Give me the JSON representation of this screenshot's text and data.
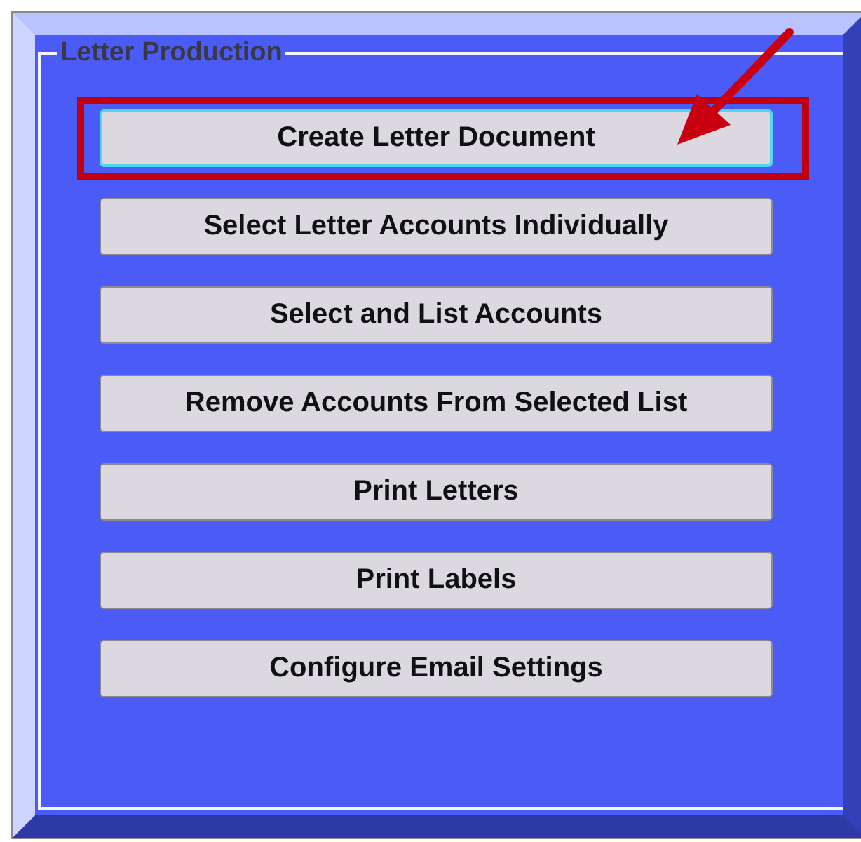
{
  "group": {
    "title": "Letter Production"
  },
  "buttons": [
    {
      "label": "Create Letter Document",
      "focused": true,
      "highlighted": true
    },
    {
      "label": "Select Letter Accounts Individually",
      "focused": false,
      "highlighted": false
    },
    {
      "label": "Select and List Accounts",
      "focused": false,
      "highlighted": false
    },
    {
      "label": "Remove Accounts From Selected List",
      "focused": false,
      "highlighted": false
    },
    {
      "label": "Print Letters",
      "focused": false,
      "highlighted": false
    },
    {
      "label": "Print Labels",
      "focused": false,
      "highlighted": false
    },
    {
      "label": "Configure Email Settings",
      "focused": false,
      "highlighted": false
    }
  ],
  "annotation": {
    "arrow": true
  }
}
